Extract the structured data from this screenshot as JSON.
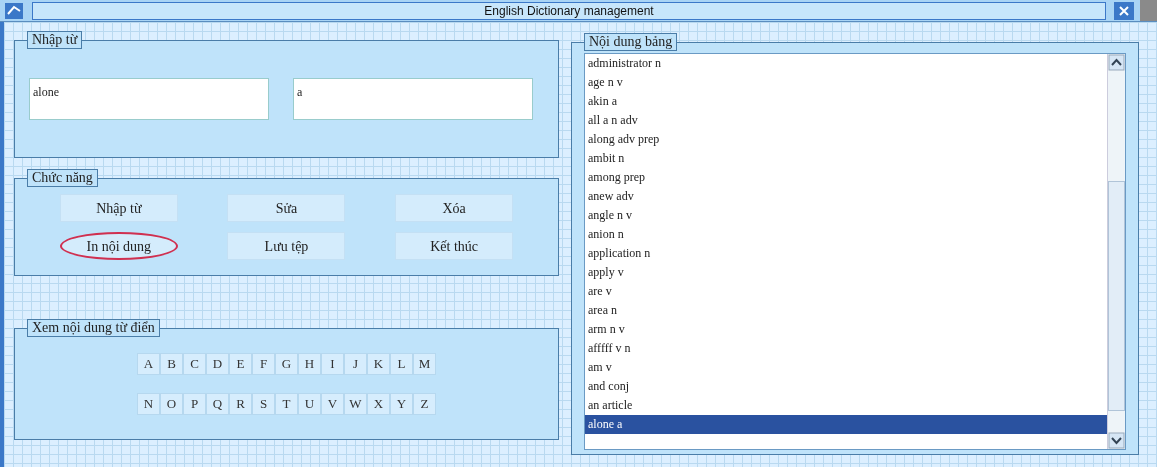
{
  "window": {
    "title": "English Dictionary management"
  },
  "input_group": {
    "title": "Nhập từ",
    "fields": [
      {
        "value": "alone"
      },
      {
        "value": "a"
      }
    ]
  },
  "function_group": {
    "title": "Chức năng",
    "buttons": [
      {
        "label": "Nhập từ",
        "circled": false
      },
      {
        "label": "Sửa",
        "circled": false
      },
      {
        "label": "Xóa",
        "circled": false
      },
      {
        "label": "In nội dung",
        "circled": true
      },
      {
        "label": "Lưu tệp",
        "circled": false
      },
      {
        "label": "Kết thúc",
        "circled": false
      }
    ]
  },
  "browse_group": {
    "title": "Xem nội dung từ điển",
    "rows": [
      [
        "A",
        "B",
        "C",
        "D",
        "E",
        "F",
        "G",
        "H",
        "I",
        "J",
        "K",
        "L",
        "M"
      ],
      [
        "N",
        "O",
        "P",
        "Q",
        "R",
        "S",
        "T",
        "U",
        "V",
        "W",
        "X",
        "Y",
        "Z"
      ]
    ]
  },
  "table_group": {
    "title": "Nội dung bảng",
    "items": [
      {
        "text": "administrator n",
        "selected": false
      },
      {
        "text": "age n v",
        "selected": false
      },
      {
        "text": "akin a",
        "selected": false
      },
      {
        "text": "all a n adv",
        "selected": false
      },
      {
        "text": "along adv prep",
        "selected": false
      },
      {
        "text": "ambit n",
        "selected": false
      },
      {
        "text": "among prep",
        "selected": false
      },
      {
        "text": "anew adv",
        "selected": false
      },
      {
        "text": "angle n v",
        "selected": false
      },
      {
        "text": "anion n",
        "selected": false
      },
      {
        "text": "application n",
        "selected": false
      },
      {
        "text": "apply v",
        "selected": false
      },
      {
        "text": "are v",
        "selected": false
      },
      {
        "text": "area n",
        "selected": false
      },
      {
        "text": "arm n v",
        "selected": false
      },
      {
        "text": "afffff v n",
        "selected": false
      },
      {
        "text": "am v",
        "selected": false
      },
      {
        "text": "and conj",
        "selected": false
      },
      {
        "text": "an article",
        "selected": false
      },
      {
        "text": "alone a",
        "selected": true
      }
    ]
  }
}
